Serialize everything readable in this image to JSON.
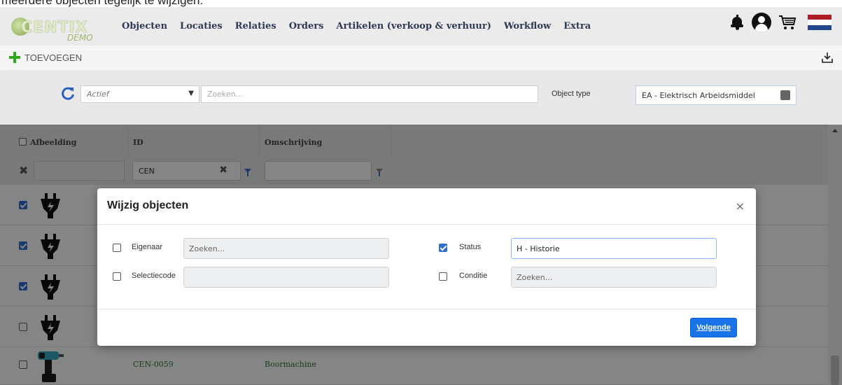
{
  "caption": "meerdere objecten tegelijk te wijzigen:",
  "navbar": {
    "logo_text": "CENTIX",
    "logo_sub": "DEMO",
    "links": [
      "Objecten",
      "Locaties",
      "Relaties",
      "Orders",
      "Artikelen (verkoop & verhuur)",
      "Workflow",
      "Extra"
    ],
    "icons": [
      "bell-icon",
      "user-icon",
      "cart-icon",
      "flag-nl-icon"
    ]
  },
  "toolbar": {
    "add_label": "TOEVOEGEN"
  },
  "filterbar": {
    "status_select": "Actief",
    "search_placeholder": "Zoeken...",
    "object_type_label": "Object type",
    "object_type_value": "EA - Elektrisch Arbeidsmiddel"
  },
  "grid": {
    "columns": [
      "Afbeelding",
      "ID",
      "Omschrijving"
    ],
    "id_filter": "CEN",
    "rows": [
      {
        "checked": true,
        "image": "plug-icon",
        "id": "",
        "description": ""
      },
      {
        "checked": true,
        "image": "plug-icon",
        "id": "",
        "description": ""
      },
      {
        "checked": true,
        "image": "plug-icon",
        "id": "",
        "description": ""
      },
      {
        "checked": false,
        "image": "plug-icon",
        "id": "",
        "description": ""
      },
      {
        "checked": false,
        "image": "drill-icon",
        "id": "CEN-0059",
        "description": "Boormachine"
      }
    ]
  },
  "modal": {
    "title": "Wijzig objecten",
    "close": "×",
    "fields": {
      "eigenaar": {
        "label": "Eigenaar",
        "checked": false,
        "placeholder": "Zoeken..."
      },
      "selectiecode": {
        "label": "Selectiecode",
        "checked": false,
        "value": ""
      },
      "status": {
        "label": "Status",
        "checked": true,
        "value": "H - Historie"
      },
      "conditie": {
        "label": "Conditie",
        "checked": false,
        "placeholder": "Zoeken..."
      }
    },
    "next_button": "Volgende"
  },
  "colors": {
    "primary": "#1a73e8",
    "check_blue": "#2f6fd3",
    "green_text": "#2e7d32",
    "add_green": "#2ea81e",
    "flag": [
      "#ae1c28",
      "#ffffff",
      "#21468b"
    ]
  }
}
